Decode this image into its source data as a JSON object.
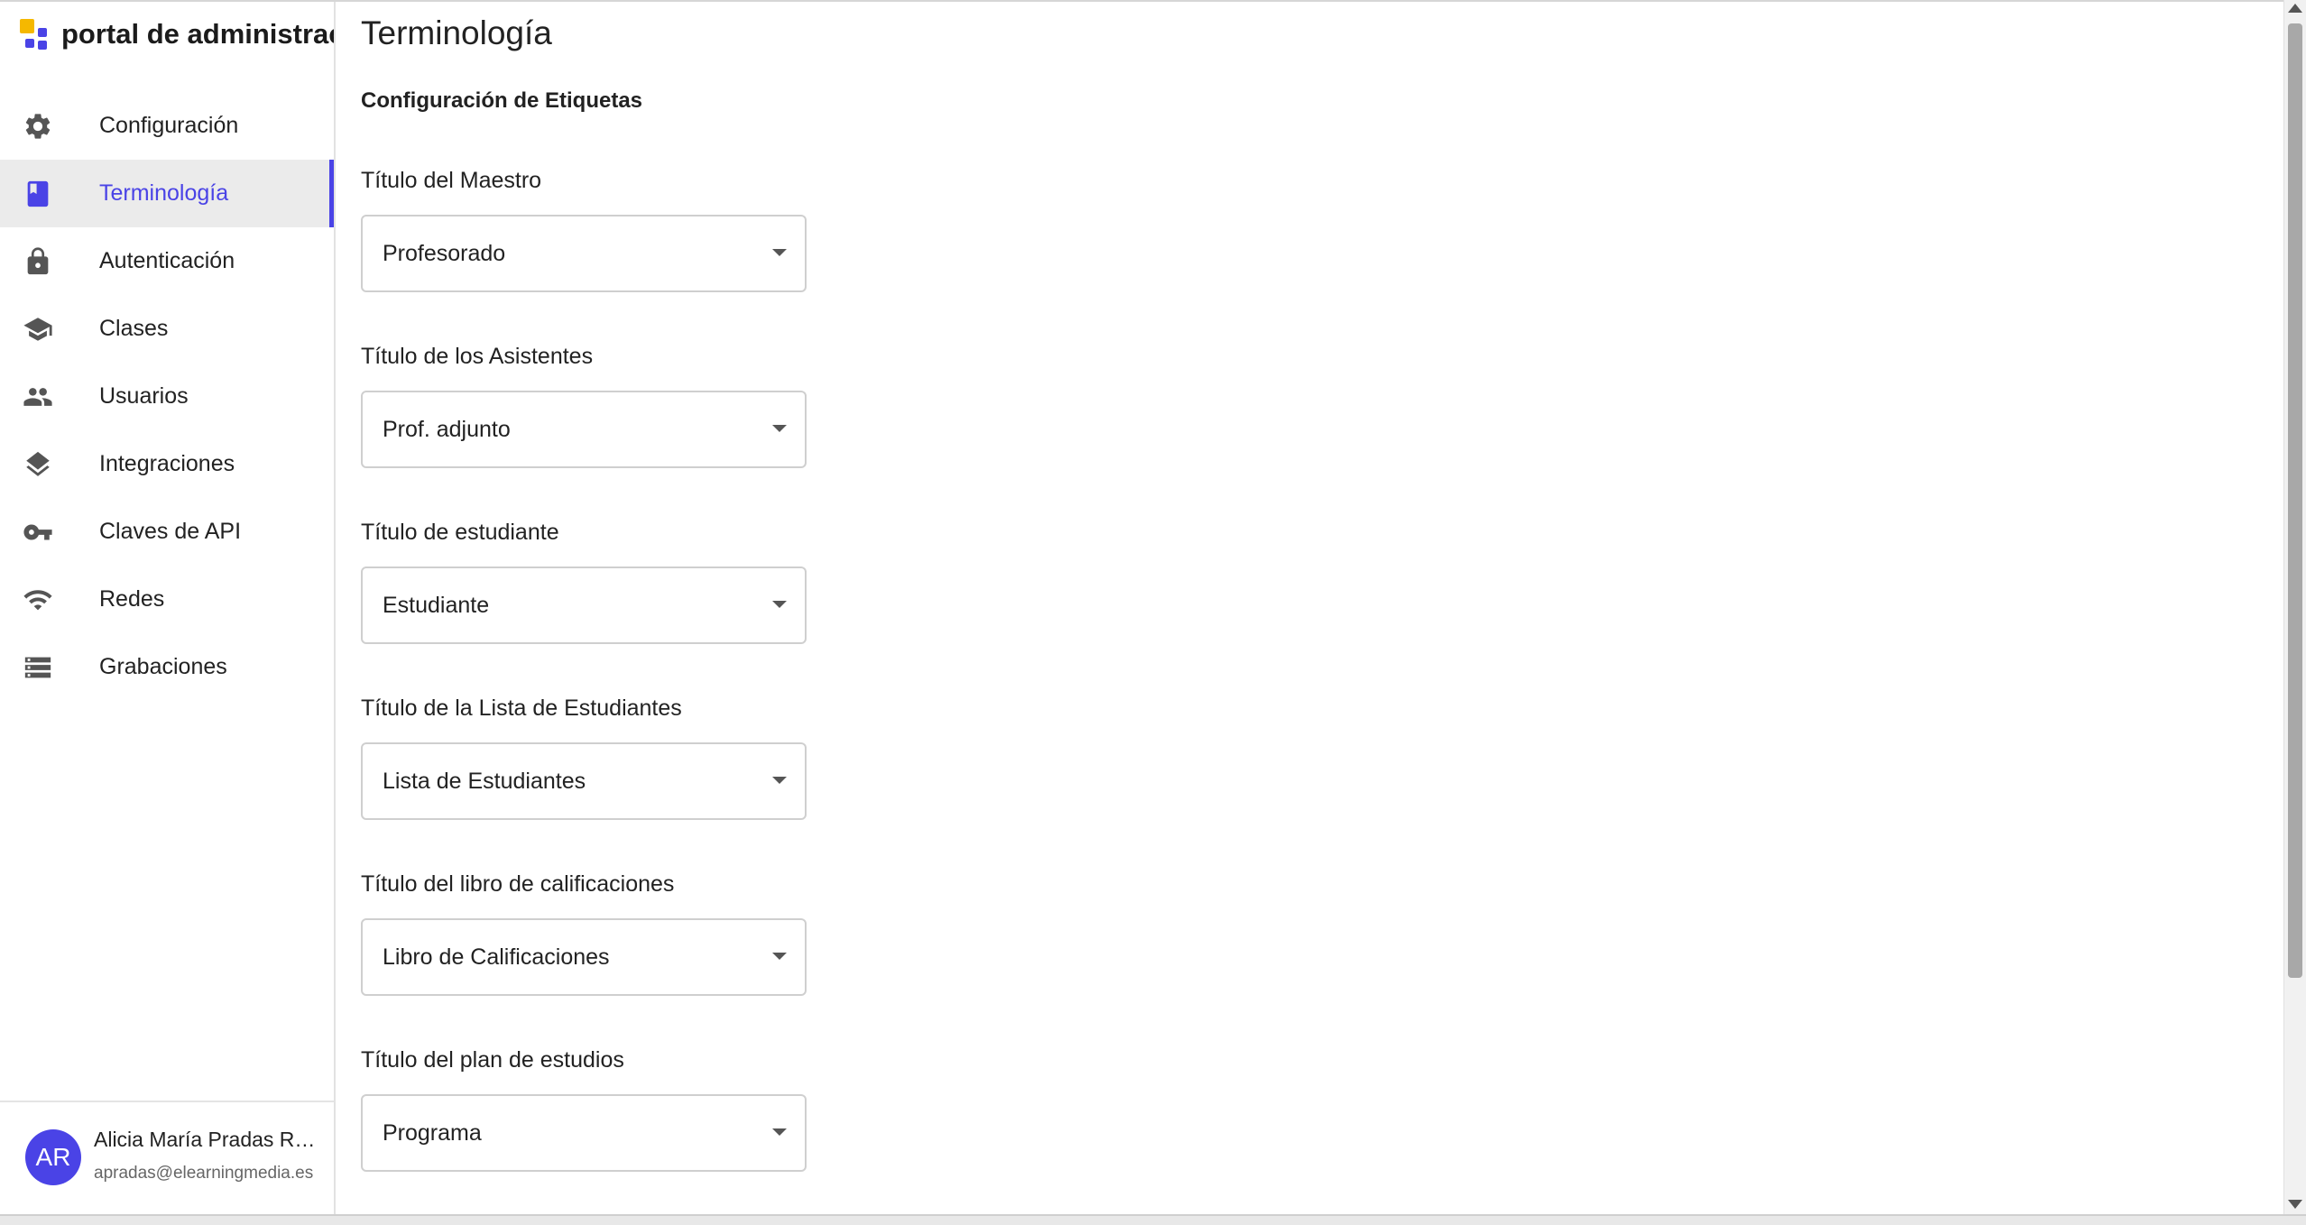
{
  "brand": {
    "name": "portal de administraci"
  },
  "nav": {
    "items": [
      {
        "label": "Configuración",
        "icon": "gear-icon"
      },
      {
        "label": "Terminología",
        "icon": "book-icon",
        "active": true
      },
      {
        "label": "Autenticación",
        "icon": "lock-icon"
      },
      {
        "label": "Clases",
        "icon": "graduation-cap-icon"
      },
      {
        "label": "Usuarios",
        "icon": "people-icon"
      },
      {
        "label": "Integraciones",
        "icon": "layers-icon"
      },
      {
        "label": "Claves de API",
        "icon": "key-icon"
      },
      {
        "label": "Redes",
        "icon": "wifi-icon"
      },
      {
        "label": "Grabaciones",
        "icon": "list-icon"
      }
    ]
  },
  "user": {
    "initials": "AR",
    "name": "Alicia María Pradas Ro...",
    "email": "apradas@elearningmedia.es"
  },
  "main": {
    "title": "Terminología",
    "section_title": "Configuración de Etiquetas",
    "fields": [
      {
        "label": "Título del Maestro",
        "value": "Profesorado"
      },
      {
        "label": "Título de los Asistentes",
        "value": "Prof. adjunto"
      },
      {
        "label": "Título de estudiante",
        "value": "Estudiante"
      },
      {
        "label": "Título de la Lista de Estudiantes",
        "value": "Lista de Estudiantes"
      },
      {
        "label": "Título del libro de calificaciones",
        "value": "Libro de Calificaciones"
      },
      {
        "label": "Título del plan de estudios",
        "value": "Programa"
      }
    ]
  },
  "colors": {
    "accent": "#4a43e6",
    "active_bg": "#ebebeb",
    "logo_yellow": "#f5b800"
  }
}
